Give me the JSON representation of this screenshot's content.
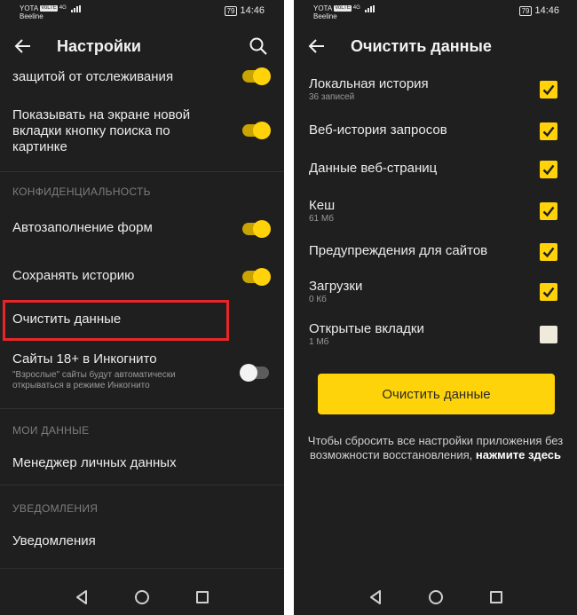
{
  "left_screen": {
    "status": {
      "carrier": "YOTA",
      "volte": "VoLTE",
      "network": "4G",
      "carrier2": "Beeline",
      "battery": "79",
      "time": "14:46"
    },
    "title": "Настройки",
    "partial_item": "защитой от отслеживания",
    "items": {
      "search_button_image": "Показывать на экране новой вкладки кнопку поиска по картинке",
      "privacy_section": "КОНФИДЕНЦИАЛЬНОСТЬ",
      "autofill": "Автозаполнение форм",
      "save_history": "Сохранять историю",
      "clear_data": "Очистить данные",
      "adult_sites": "Сайты 18+ в Инкогнито",
      "adult_sites_sub": "\"Взрослые\" сайты будут автоматически открываться в режиме Инкогнито",
      "my_data_section": "МОИ ДАННЫЕ",
      "personal_data": "Менеджер личных данных",
      "notifications_section": "УВЕДОМЛЕНИЯ",
      "notifications": "Уведомления"
    },
    "toggles": {
      "tracking": true,
      "search_button_image": true,
      "autofill": true,
      "save_history": true,
      "adult_sites": false
    }
  },
  "right_screen": {
    "status": {
      "carrier": "YOTA",
      "volte": "VoLTE",
      "network": "4G",
      "carrier2": "Beeline",
      "battery": "79",
      "time": "14:46"
    },
    "title": "Очистить данные",
    "options": [
      {
        "label": "Локальная история",
        "sub": "36 записей",
        "checked": true
      },
      {
        "label": "Веб-история запросов",
        "sub": "",
        "checked": true
      },
      {
        "label": "Данные веб-страниц",
        "sub": "",
        "checked": true
      },
      {
        "label": "Кеш",
        "sub": "61 Мб",
        "checked": true
      },
      {
        "label": "Предупреждения для сайтов",
        "sub": "",
        "checked": true
      },
      {
        "label": "Загрузки",
        "sub": "0 Кб",
        "checked": true
      },
      {
        "label": "Открытые вкладки",
        "sub": "1 Мб",
        "checked": false
      }
    ],
    "clear_button": "Очистить данные",
    "reset_note": "Чтобы сбросить все настройки приложения без возможности восстановления,",
    "reset_link": "нажмите здесь"
  },
  "colors": {
    "background": "#1f1f1f",
    "accent": "#ffd20a",
    "highlight": "#e8262a"
  },
  "icons": [
    "back-arrow-icon",
    "search-icon",
    "nav-back-icon",
    "nav-home-icon",
    "nav-recent-icon",
    "checkmark-icon"
  ]
}
